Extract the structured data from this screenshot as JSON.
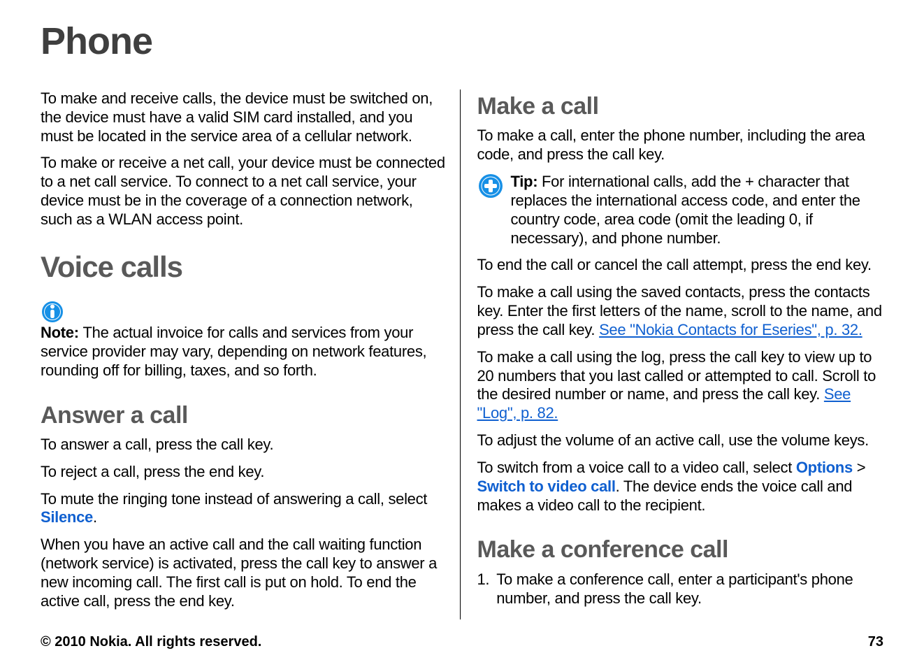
{
  "page_title": "Phone",
  "left": {
    "intro1": "To make and receive calls, the device must be switched on, the device must have a valid SIM card installed, and you must be located in the service area of a cellular network.",
    "intro2": "To make or receive a net call, your device must be connected to a net call service. To connect to a net call service, your device must be in the coverage of a connection network, such as a WLAN access point.",
    "voice_calls_heading": "Voice calls",
    "note_label": "Note:  ",
    "note_body": "The actual invoice for calls and services from your service provider may vary, depending on network features, rounding off for billing, taxes, and so forth.",
    "answer_heading": "Answer a call",
    "answer_p1": "To answer a call, press the call key.",
    "answer_p2": "To reject a call, press the end key.",
    "mute_pre": "To mute the ringing tone instead of answering a call, select ",
    "mute_silence": "Silence",
    "mute_post": ".",
    "answer_p4": "When you have an active call and the call waiting function (network service) is activated, press the call key to answer a new incoming call. The first call is put on hold. To end the active call, press the end key."
  },
  "right": {
    "make_heading": "Make a call",
    "make_p1": "To make a call, enter the phone number, including the area code, and press the call key.",
    "tip_label": "Tip:  ",
    "tip_body": "For international calls, add the + character that replaces the international access code, and enter the country code, area code (omit the leading 0, if necessary), and phone number.",
    "end_call": "To end the call or cancel the call attempt, press the end key.",
    "contacts_pre": "To make a call using the saved contacts, press the contacts key. Enter the first letters of the name, scroll to the name, and press the call key. ",
    "contacts_link": "See \"Nokia Contacts for Eseries\", p. 32.",
    "log_pre": "To make a call using the log, press the call key to view up to 20 numbers that you last called or attempted to call. Scroll to the desired number or name, and press the call key. ",
    "log_link": "See \"Log\", p. 82.",
    "volume": "To adjust the volume of an active call, use the volume keys.",
    "switch_pre": "To switch from a voice call to a video call, select ",
    "options_label": "Options",
    "angle": "  > ",
    "switch_label": "Switch to video call",
    "switch_post": ". The device ends the voice call and makes a video call to the recipient.",
    "conf_heading": "Make a conference call",
    "conf_step1_num": "1.",
    "conf_step1": "To make a conference call, enter a participant's phone number, and press the call key."
  },
  "footer": {
    "copyright": "© 2010 Nokia. All rights reserved.",
    "page_number": "73"
  },
  "links": {
    "contacts_ref": "p. 32",
    "log_ref": "p. 82"
  },
  "colors": {
    "accent": "#1060d0",
    "heading": "#555555"
  }
}
